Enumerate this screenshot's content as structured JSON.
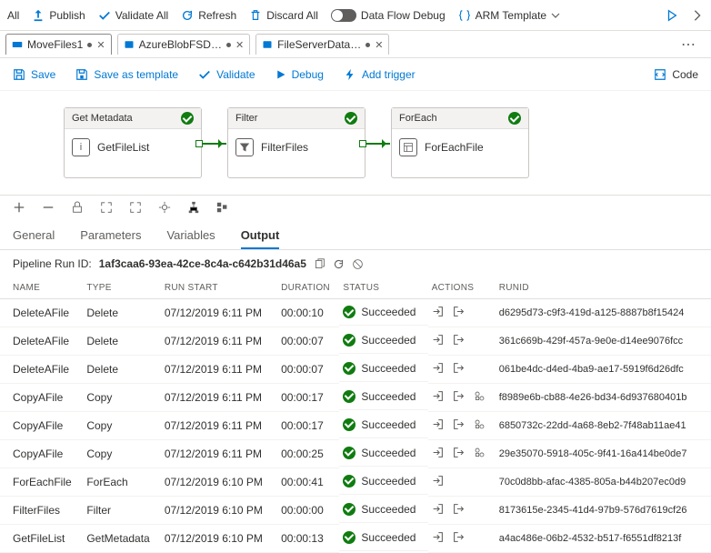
{
  "toolbar": {
    "all": "All",
    "publish": "Publish",
    "validate_all": "Validate All",
    "refresh": "Refresh",
    "discard_all": "Discard All",
    "debug_toggle": "Data Flow Debug",
    "arm": "ARM Template"
  },
  "doc_tabs": [
    {
      "label": "MoveFiles1",
      "active": true,
      "modified": true
    },
    {
      "label": "AzureBlobFSD…",
      "active": false,
      "modified": true
    },
    {
      "label": "FileServerData…",
      "active": false,
      "modified": true
    }
  ],
  "actionbar": {
    "save": "Save",
    "save_template": "Save as template",
    "validate": "Validate",
    "debug": "Debug",
    "add_trigger": "Add trigger",
    "code": "Code"
  },
  "activities": [
    {
      "type": "Get Metadata",
      "name": "GetFileList",
      "icon": "info"
    },
    {
      "type": "Filter",
      "name": "FilterFiles",
      "icon": "filter"
    },
    {
      "type": "ForEach",
      "name": "ForEachFile",
      "icon": "foreach"
    }
  ],
  "panel_tabs": {
    "general": "General",
    "parameters": "Parameters",
    "variables": "Variables",
    "output": "Output"
  },
  "run_id_label": "Pipeline Run ID:",
  "run_id": "1af3caa6-93ea-42ce-8c4a-c642b31d46a5",
  "columns": {
    "name": "Name",
    "type": "Type",
    "run_start": "Run Start",
    "duration": "Duration",
    "status": "Status",
    "actions": "Actions",
    "runid": "RunID"
  },
  "status_label": "Succeeded",
  "rows": [
    {
      "name": "DeleteAFile",
      "type": "Delete",
      "start": "07/12/2019 6:11 PM",
      "dur": "00:00:10",
      "actions": "io",
      "runid": "d6295d73-c9f3-419d-a125-8887b8f15424"
    },
    {
      "name": "DeleteAFile",
      "type": "Delete",
      "start": "07/12/2019 6:11 PM",
      "dur": "00:00:07",
      "actions": "io",
      "runid": "361c669b-429f-457a-9e0e-d14ee9076fcc"
    },
    {
      "name": "DeleteAFile",
      "type": "Delete",
      "start": "07/12/2019 6:11 PM",
      "dur": "00:00:07",
      "actions": "io",
      "runid": "061be4dc-d4ed-4ba9-ae17-5919f6d26dfc"
    },
    {
      "name": "CopyAFile",
      "type": "Copy",
      "start": "07/12/2019 6:11 PM",
      "dur": "00:00:17",
      "actions": "iog",
      "runid": "f8989e6b-cb88-4e26-bd34-6d937680401b"
    },
    {
      "name": "CopyAFile",
      "type": "Copy",
      "start": "07/12/2019 6:11 PM",
      "dur": "00:00:17",
      "actions": "iog",
      "runid": "6850732c-22dd-4a68-8eb2-7f48ab11ae41"
    },
    {
      "name": "CopyAFile",
      "type": "Copy",
      "start": "07/12/2019 6:11 PM",
      "dur": "00:00:25",
      "actions": "iog",
      "runid": "29e35070-5918-405c-9f41-16a414be0de7"
    },
    {
      "name": "ForEachFile",
      "type": "ForEach",
      "start": "07/12/2019 6:10 PM",
      "dur": "00:00:41",
      "actions": "i",
      "runid": "70c0d8bb-afac-4385-805a-b44b207ec0d9"
    },
    {
      "name": "FilterFiles",
      "type": "Filter",
      "start": "07/12/2019 6:10 PM",
      "dur": "00:00:00",
      "actions": "io",
      "runid": "8173615e-2345-41d4-97b9-576d7619cf26"
    },
    {
      "name": "GetFileList",
      "type": "GetMetadata",
      "start": "07/12/2019 6:10 PM",
      "dur": "00:00:13",
      "actions": "io",
      "runid": "a4ac486e-06b2-4532-b517-f6551df8213f"
    }
  ]
}
